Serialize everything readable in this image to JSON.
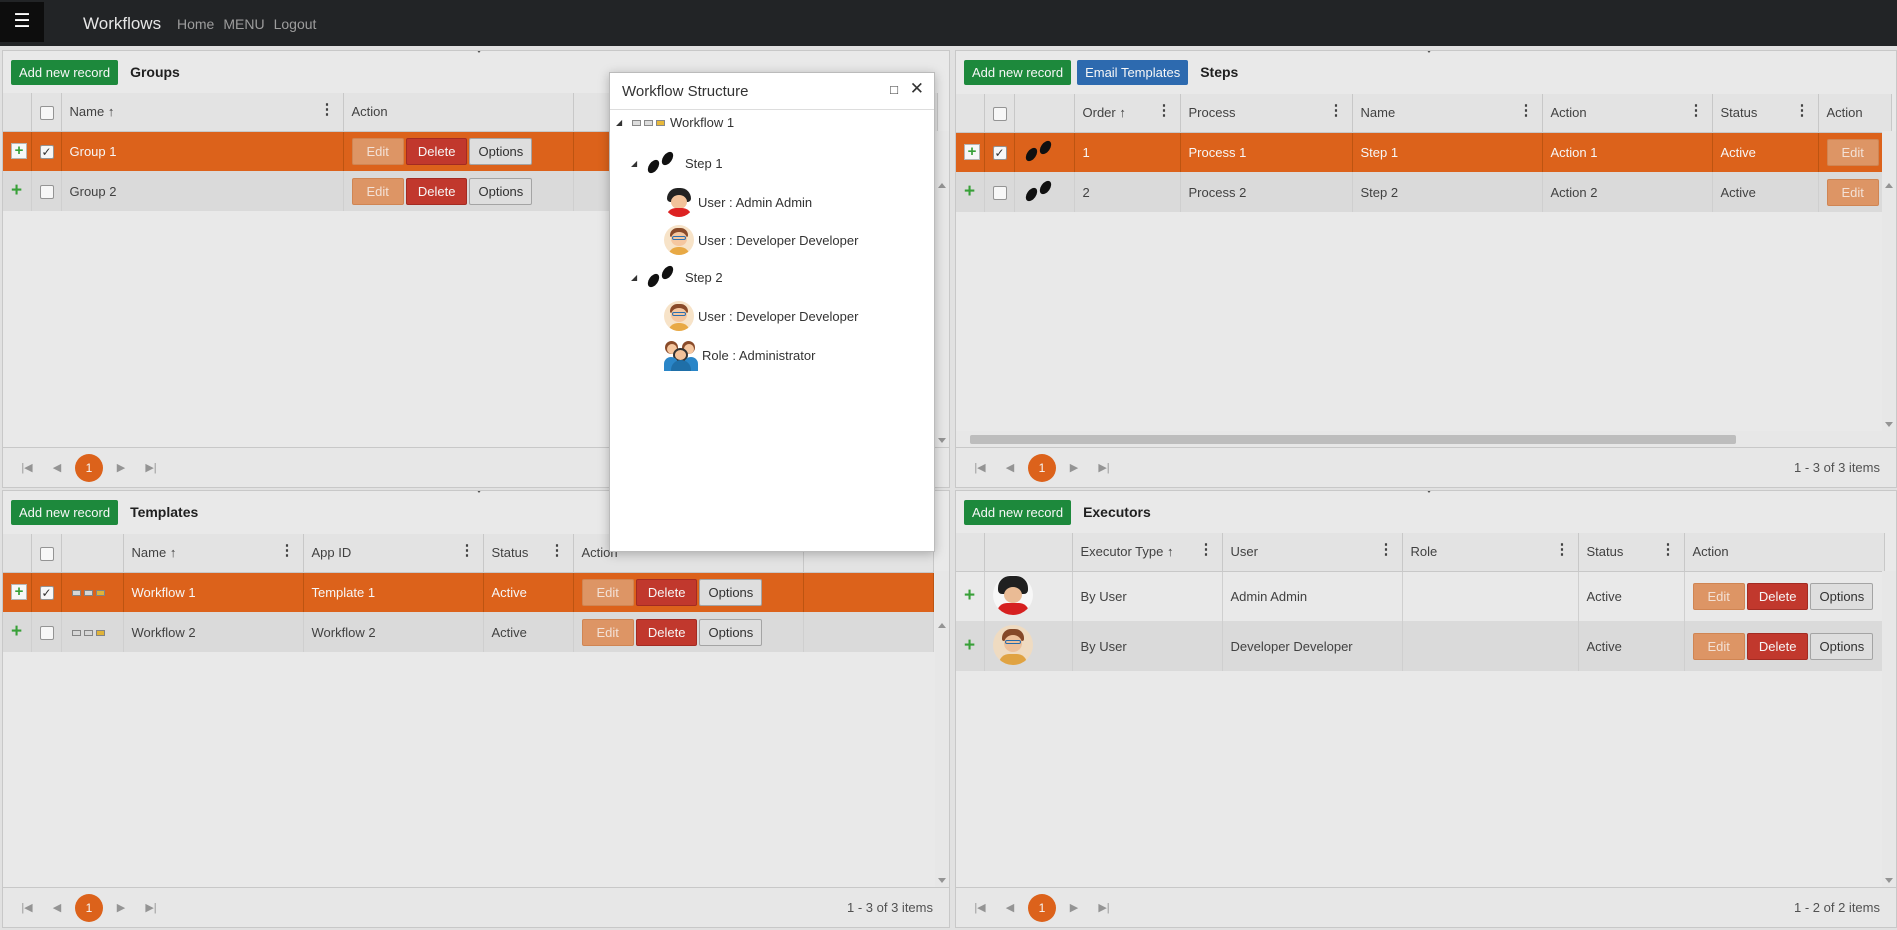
{
  "app": {
    "brand": "Workflows",
    "nav": [
      "Home",
      "MENU",
      "Logout"
    ],
    "menu_icon": "hamburger-icon"
  },
  "groups": {
    "add_label": "Add new record",
    "title": "Groups",
    "columns": {
      "name": "Name",
      "action": "Action"
    },
    "rows": [
      {
        "name": "Group 1",
        "selected": true
      },
      {
        "name": "Group 2",
        "selected": false
      }
    ],
    "pager": {
      "current": "1",
      "info": ""
    }
  },
  "steps": {
    "add_label": "Add new record",
    "email_label": "Email Templates",
    "title": "Steps",
    "columns": {
      "order": "Order",
      "process": "Process",
      "name": "Name",
      "action": "Action",
      "status": "Status",
      "action2": "Action"
    },
    "rows": [
      {
        "order": "1",
        "process": "Process 1",
        "name": "Step 1",
        "action": "Action 1",
        "status": "Active",
        "selected": true
      },
      {
        "order": "2",
        "process": "Process 2",
        "name": "Step 2",
        "action": "Action 2",
        "status": "Active",
        "selected": false
      }
    ],
    "pager": {
      "current": "1",
      "info": "1 - 3 of 3 items"
    }
  },
  "templates": {
    "add_label": "Add new record",
    "title": "Templates",
    "columns": {
      "name": "Name",
      "app_id": "App ID",
      "status": "Status",
      "action": "Action"
    },
    "rows": [
      {
        "name": "Workflow 1",
        "app_id": "Template 1",
        "status": "Active",
        "selected": true
      },
      {
        "name": "Workflow 2",
        "app_id": "Workflow 2",
        "status": "Active",
        "selected": false
      }
    ],
    "pager": {
      "current": "1",
      "info": "1 - 3 of 3 items"
    }
  },
  "executors": {
    "add_label": "Add new record",
    "title": "Executors",
    "columns": {
      "type": "Executor Type",
      "user": "User",
      "role": "Role",
      "status": "Status",
      "action": "Action"
    },
    "rows": [
      {
        "type": "By User",
        "user": "Admin Admin",
        "role": "",
        "status": "Active"
      },
      {
        "type": "By User",
        "user": "Developer Developer",
        "role": "",
        "status": "Active"
      }
    ],
    "pager": {
      "current": "1",
      "info": "1 - 2 of 2 items"
    }
  },
  "buttons": {
    "edit": "Edit",
    "delete": "Delete",
    "options": "Options"
  },
  "modal": {
    "title": "Workflow Structure",
    "tree": {
      "root": "Workflow 1",
      "step1": "Step 1",
      "step1_user1": "User : Admin Admin",
      "step1_user2": "User : Developer Developer",
      "step2": "Step 2",
      "step2_user1": "User : Developer Developer",
      "step2_role1": "Role : Administrator"
    }
  },
  "colors": {
    "accent": "#e4661c",
    "green": "#1e8e3e",
    "blue": "#2f6eb5",
    "delete": "#c83a2f",
    "topbar": "#222426"
  }
}
